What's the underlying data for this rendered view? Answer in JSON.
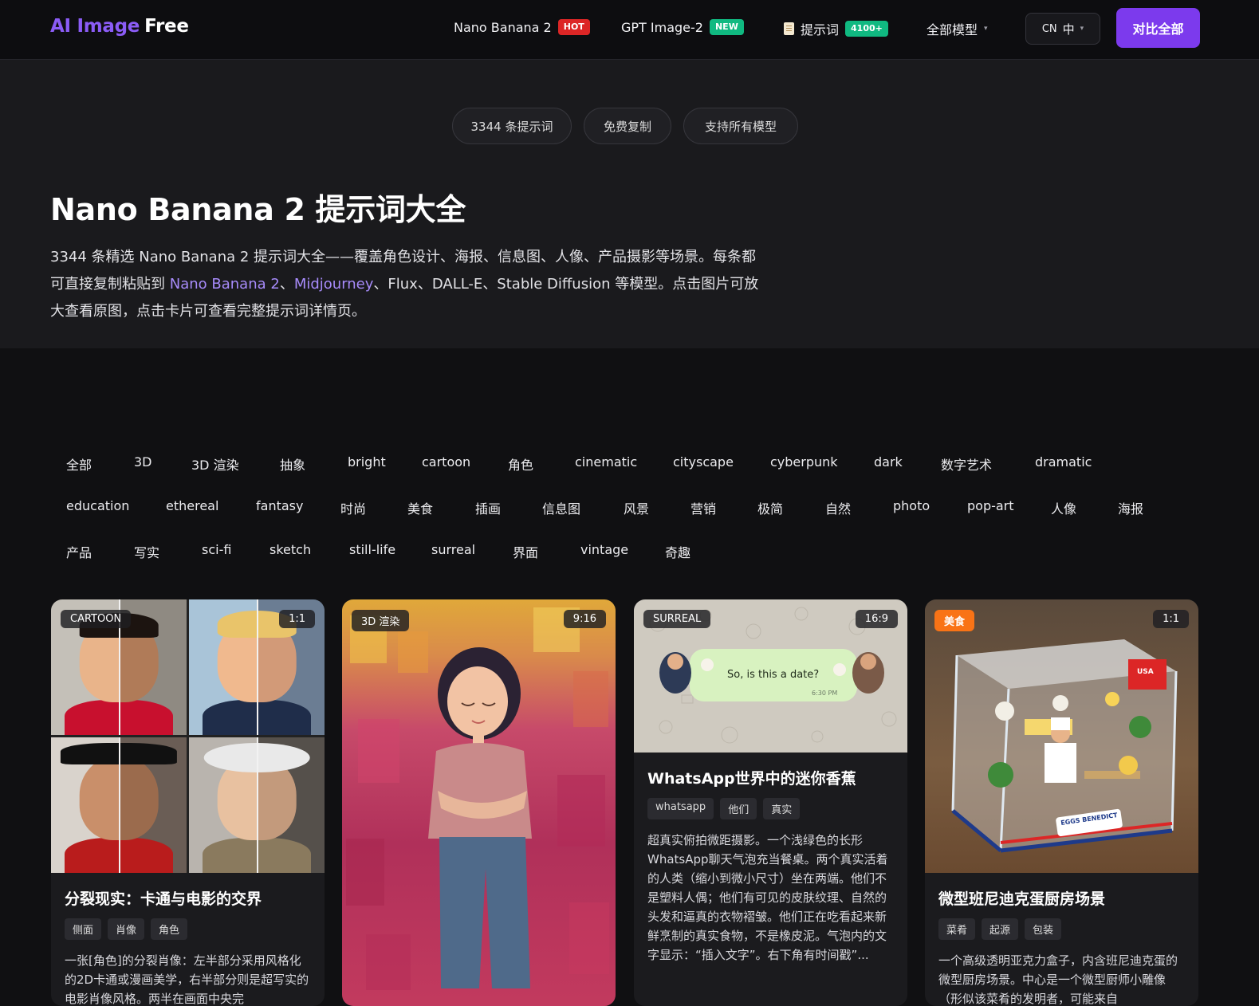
{
  "nav": {
    "logo_ai": "AI Image",
    "logo_free": "Free",
    "links": [
      {
        "label": "Nano Banana 2",
        "badge": "HOT"
      },
      {
        "label": "GPT Image-2",
        "badge": "NEW"
      },
      {
        "label": "提示词",
        "badge": "4100+"
      },
      {
        "label": "全部模型"
      }
    ],
    "lang_code": "CN",
    "lang_label": "中",
    "cta": "对比全部"
  },
  "hero": {
    "pills": [
      "3344 条提示词",
      "免费复制",
      "支持所有模型"
    ],
    "title": "Nano Banana 2 提示词大全",
    "desc_1": "3344 条精选 Nano Banana 2 提示词大全——覆盖角色设计、海报、信息图、人像、产品摄影等场景。每条都可直接复制粘贴到 ",
    "link_1": "Nano Banana 2",
    "sep_1": "、",
    "link_2": "Midjourney",
    "desc_2": "、Flux、DALL-E、Stable Diffusion 等模型。点击图片可放大查看原图，点击卡片可查看完整提示词详情页。"
  },
  "tags": [
    "全部",
    "3D",
    "3D 渲染",
    "抽象",
    "bright",
    "cartoon",
    "角色",
    "cinematic",
    "cityscape",
    "cyberpunk",
    "dark",
    "数字艺术",
    "dramatic",
    "education",
    "ethereal",
    "fantasy",
    "时尚",
    "美食",
    "插画",
    "信息图",
    "风景",
    "营销",
    "极简",
    "自然",
    "photo",
    "pop-art",
    "人像",
    "海报",
    "产品",
    "写实",
    "sci-fi",
    "sketch",
    "still-life",
    "surreal",
    "界面",
    "vintage",
    "奇趣"
  ],
  "cards": [
    {
      "category": "CARTOON",
      "ratio": "1:1",
      "title": "分裂现实：卡通与电影的交界",
      "keywords": [
        "侧面",
        "肖像",
        "角色"
      ],
      "desc": "一张[角色]的分裂肖像：左半部分采用风格化的2D卡通或漫画美学，右半部分则是超写实的电影肖像风格。两半在画面中央完"
    },
    {
      "category": "3D 渲染",
      "ratio": "9:16"
    },
    {
      "category": "SURREAL",
      "ratio": "16:9",
      "bubble_text": "So, is this a date?",
      "bubble_time": "6:30 PM",
      "title": "WhatsApp世界中的迷你香蕉",
      "keywords": [
        "whatsapp",
        "他们",
        "真实"
      ],
      "desc": "超真实俯拍微距摄影。一个浅绿色的长形WhatsApp聊天气泡充当餐桌。两个真实活着的人类（缩小到微小尺寸）坐在两端。他们不是塑料人偶；他们有可见的皮肤纹理、自然的头发和逼真的衣物褶皱。他们正在吃看起来新鲜烹制的真实食物，不是橡皮泥。气泡内的文字显示：“插入文字”。右下角有时间戳”..."
    },
    {
      "category": "美食",
      "ratio": "1:1",
      "sign_usa": "USA",
      "plate_text": "EGGS BENEDICT",
      "title": "微型班尼迪克蛋厨房场景",
      "keywords": [
        "菜肴",
        "起源",
        "包装"
      ],
      "desc": "一个高级透明亚克力盒子，内含班尼迪克蛋的微型厨房场景。中心是一个微型厨师小雕像（形似该菜肴的发明者，可能来自"
    }
  ],
  "colors": {
    "accent": "#7c3aed",
    "accent_text": "#a78bfa",
    "hot_badge": "#dc2626",
    "new_badge": "#10b981"
  }
}
